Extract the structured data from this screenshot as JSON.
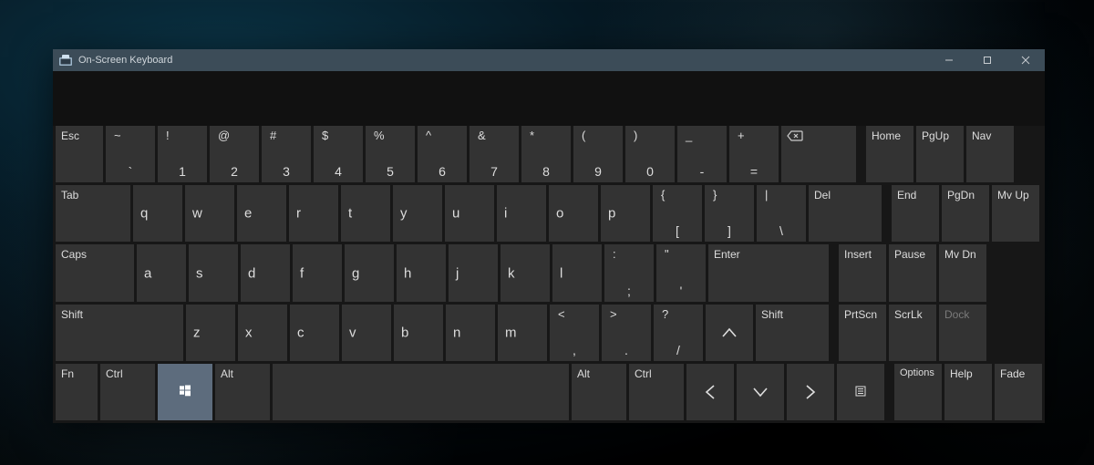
{
  "window": {
    "title": "On-Screen Keyboard"
  },
  "rows": {
    "r1": {
      "esc": "Esc",
      "k1": {
        "s": "~",
        "m": "`"
      },
      "k2": {
        "s": "!",
        "m": "1"
      },
      "k3": {
        "s": "@",
        "m": "2"
      },
      "k4": {
        "s": "#",
        "m": "3"
      },
      "k5": {
        "s": "$",
        "m": "4"
      },
      "k6": {
        "s": "%",
        "m": "5"
      },
      "k7": {
        "s": "^",
        "m": "6"
      },
      "k8": {
        "s": "&",
        "m": "7"
      },
      "k9": {
        "s": "*",
        "m": "8"
      },
      "k10": {
        "s": "(",
        "m": "9"
      },
      "k11": {
        "s": ")",
        "m": "0"
      },
      "k12": {
        "s": "_",
        "m": "-"
      },
      "k13": {
        "s": "+",
        "m": "="
      },
      "bksp": "⌫",
      "side": [
        "Home",
        "PgUp",
        "Nav"
      ]
    },
    "r2": {
      "tab": "Tab",
      "letters": [
        "q",
        "w",
        "e",
        "r",
        "t",
        "y",
        "u",
        "i",
        "o",
        "p"
      ],
      "k11": {
        "s": "{",
        "m": "["
      },
      "k12": {
        "s": "}",
        "m": "]"
      },
      "k13": {
        "s": "|",
        "m": "\\"
      },
      "del": "Del",
      "side": [
        "End",
        "PgDn",
        "Mv Up"
      ]
    },
    "r3": {
      "caps": "Caps",
      "letters": [
        "a",
        "s",
        "d",
        "f",
        "g",
        "h",
        "j",
        "k",
        "l"
      ],
      "k10": {
        "s": ":",
        "m": ";"
      },
      "k11": {
        "s": "\"",
        "m": "'"
      },
      "enter": "Enter",
      "side": [
        "Insert",
        "Pause",
        "Mv Dn"
      ]
    },
    "r4": {
      "shiftL": "Shift",
      "letters": [
        "z",
        "x",
        "c",
        "v",
        "b",
        "n",
        "m"
      ],
      "k8": {
        "s": "<",
        "m": ","
      },
      "k9": {
        "s": ">",
        "m": "."
      },
      "k10": {
        "s": "?",
        "m": "/"
      },
      "shiftR": "Shift",
      "side": [
        "PrtScn",
        "ScrLk",
        "Dock"
      ]
    },
    "r5": {
      "fn": "Fn",
      "ctrlL": "Ctrl",
      "altL": "Alt",
      "altR": "Alt",
      "ctrlR": "Ctrl",
      "side": [
        "Options",
        "Help",
        "Fade"
      ]
    }
  },
  "colors": {
    "key_bg": "#333333",
    "window_bg": "#171717",
    "titlebar_bg": "#3c4c58",
    "win_key_bg": "#5d6c7d"
  }
}
